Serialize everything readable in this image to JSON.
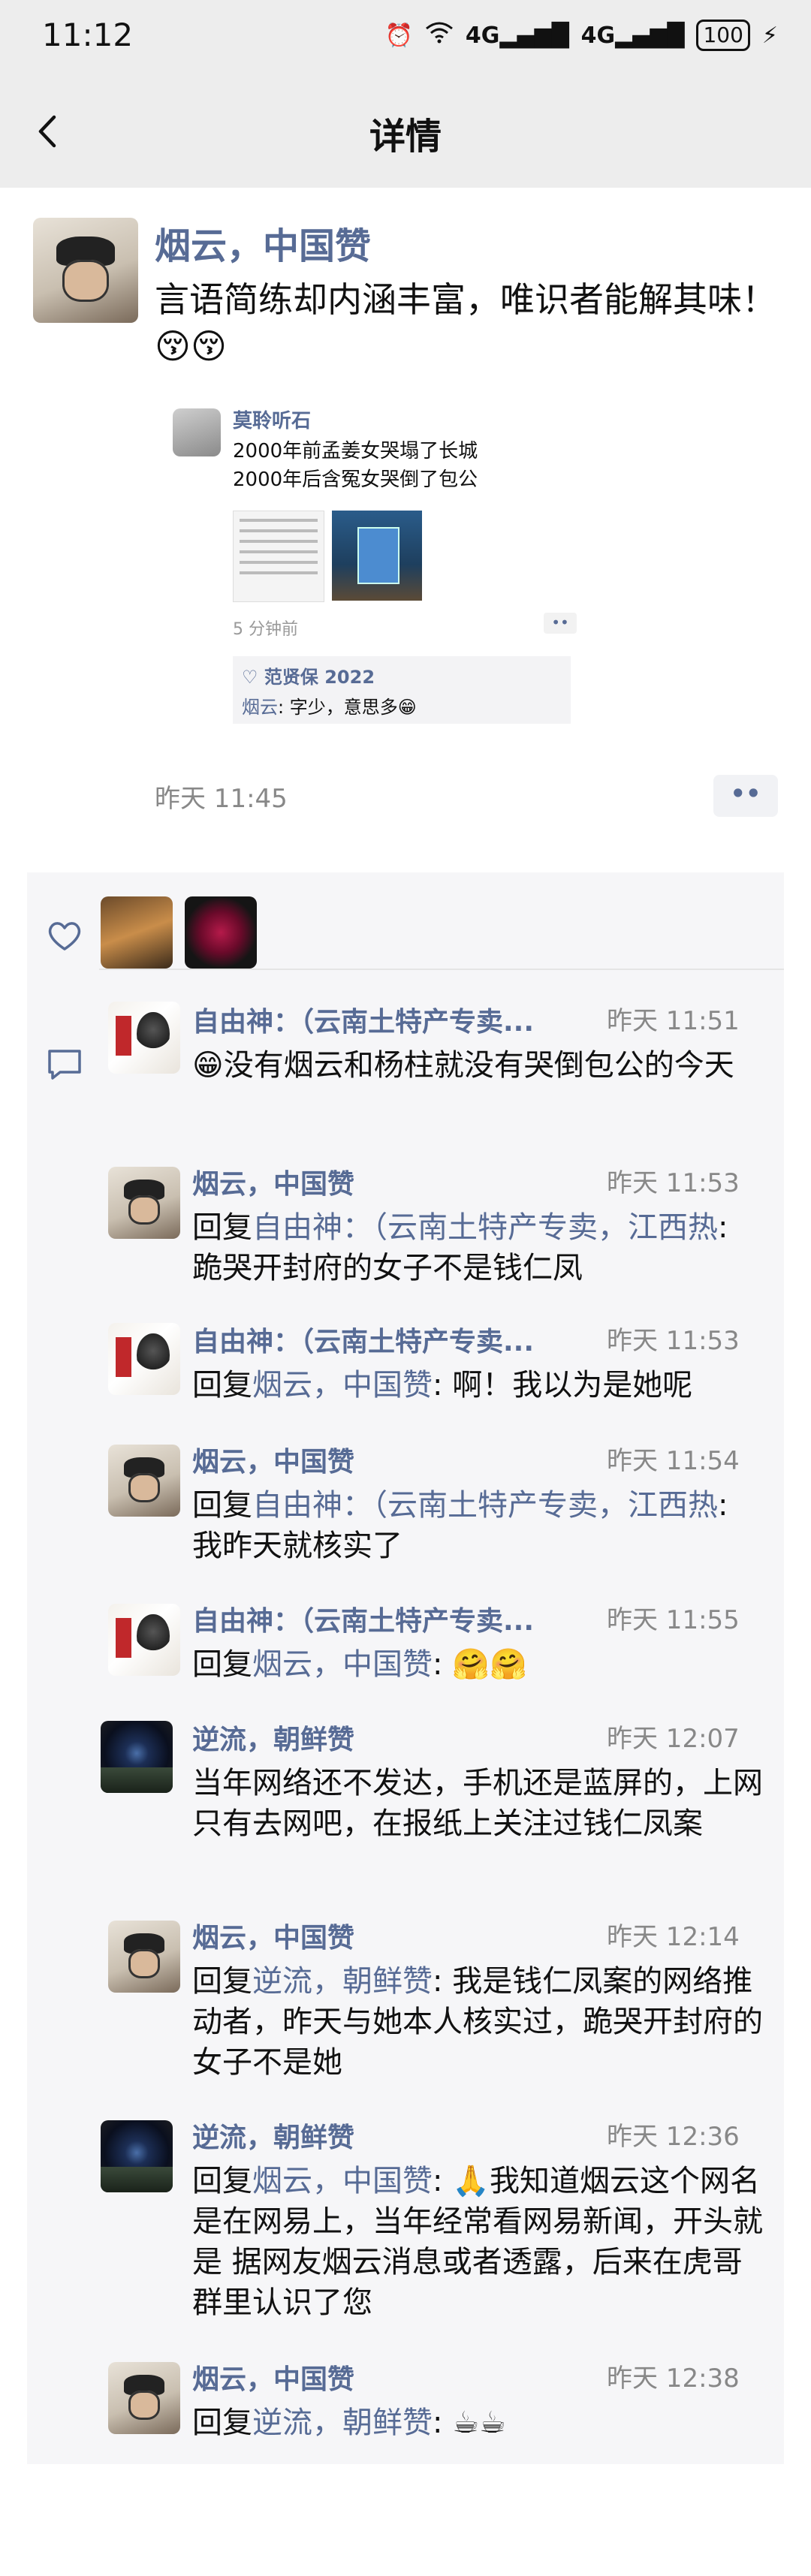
{
  "status_bar": {
    "time": "11:12",
    "network_1": "4G",
    "network_2": "4G",
    "battery": "100"
  },
  "nav": {
    "title": "详情"
  },
  "post": {
    "author": "烟云，中国赞",
    "text": "言语简练却内涵丰富，唯识者能解其味！😚😚",
    "time": "昨天 11:45",
    "more": "••",
    "shared": {
      "author": "莫聆听石",
      "line1": "2000年前孟姜女哭塌了长城",
      "line2": "2000年后含冤女哭倒了包公",
      "time": "5 分钟前",
      "more": "••",
      "like_names": "♡ 范贤保 2022",
      "comment_author": "烟云",
      "comment_text": ": 字少，意思多😁"
    }
  },
  "comments": [
    {
      "name": "自由神：（云南土特产专卖...",
      "time": "昨天 11:51",
      "text": "😁没有烟云和杨柱就没有哭倒包公的今天"
    },
    {
      "name": "烟云，中国赞",
      "time": "昨天 11:53",
      "reply_prefix": "回复",
      "reply_to": "自由神：（云南土特产专卖，江西热",
      "text": ": 跪哭开封府的女子不是钱仁凤"
    },
    {
      "name": "自由神：（云南土特产专卖...",
      "time": "昨天 11:53",
      "reply_prefix": "回复",
      "reply_to": "烟云，中国赞",
      "text": ": 啊！我以为是她呢"
    },
    {
      "name": "烟云，中国赞",
      "time": "昨天 11:54",
      "reply_prefix": "回复",
      "reply_to": "自由神：（云南土特产专卖，江西热",
      "text": ": 我昨天就核实了"
    },
    {
      "name": "自由神：（云南土特产专卖...",
      "time": "昨天 11:55",
      "reply_prefix": "回复",
      "reply_to": "烟云，中国赞",
      "text": ": 🤗🤗"
    },
    {
      "name": "逆流，朝鲜赞",
      "time": "昨天 12:07",
      "text": "当年网络还不发达，手机还是蓝屏的，上网只有去网吧，在报纸上关注过钱仁凤案"
    },
    {
      "name": "烟云，中国赞",
      "time": "昨天 12:14",
      "reply_prefix": "回复",
      "reply_to": "逆流，朝鲜赞",
      "text": ": 我是钱仁凤案的网络推动者，昨天与她本人核实过，跪哭开封府的女子不是她"
    },
    {
      "name": "逆流，朝鲜赞",
      "time": "昨天 12:36",
      "reply_prefix": "回复",
      "reply_to": "烟云，中国赞",
      "text": ": 🙏我知道烟云这个网名是在网易上，当年经常看网易新闻，开头就是 据网友烟云消息或者透露，后来在虎哥群里认识了您"
    },
    {
      "name": "烟云，中国赞",
      "time": "昨天 12:38",
      "reply_prefix": "回复",
      "reply_to": "逆流，朝鲜赞",
      "text": ": ☕☕"
    }
  ],
  "colors": {
    "link": "#576b95",
    "background_bar": "#ededed",
    "panel": "#f6f6f8"
  }
}
